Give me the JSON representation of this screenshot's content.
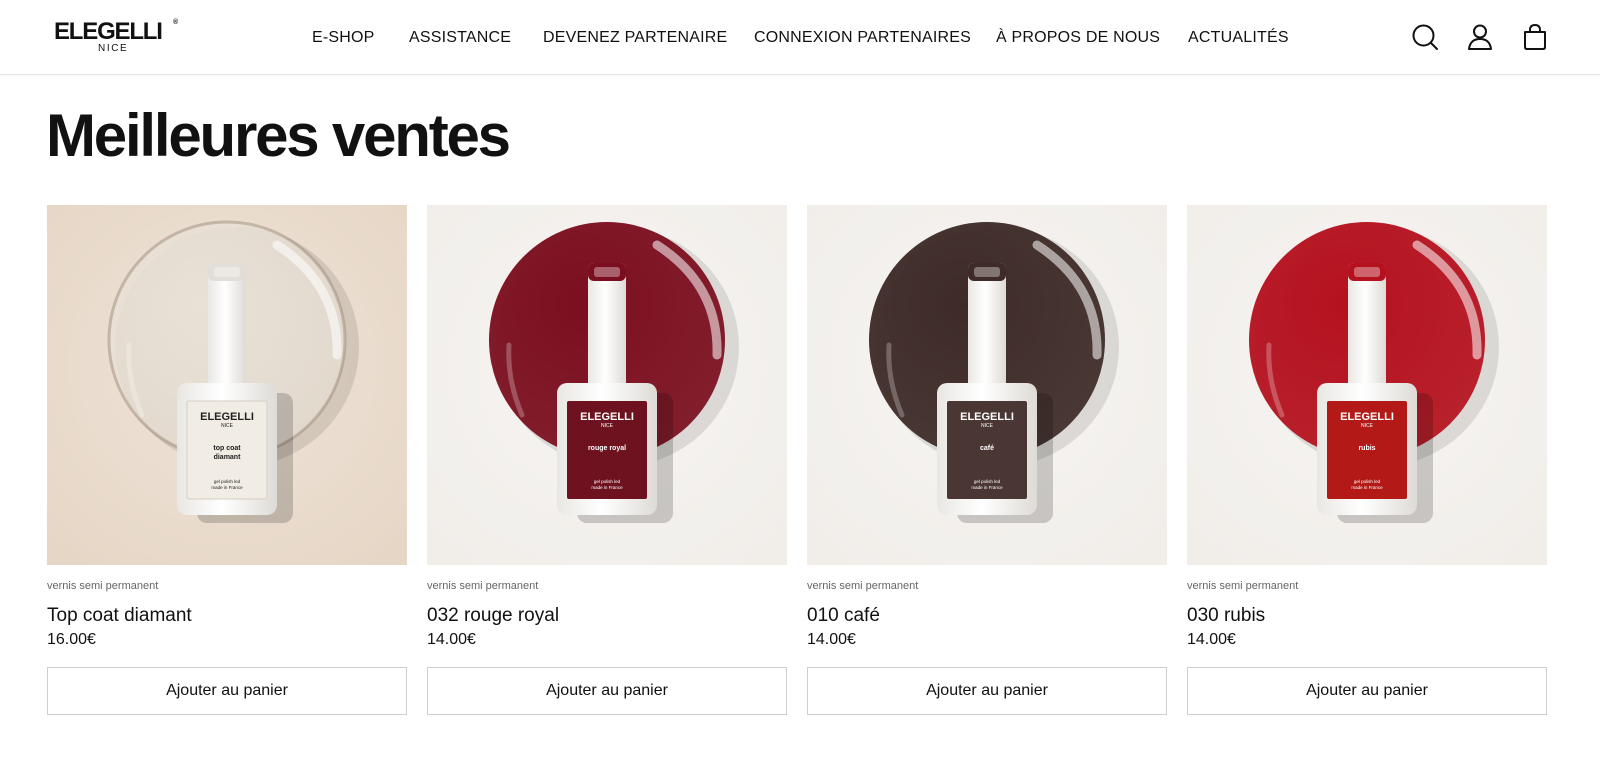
{
  "brand": {
    "logo_main": "ELEGELLI",
    "logo_registered": "®",
    "logo_sub": "NICE"
  },
  "nav": {
    "items": [
      {
        "label": "E-SHOP"
      },
      {
        "label": "ASSISTANCE"
      },
      {
        "label": "DEVENEZ PARTENAIRE"
      },
      {
        "label": "CONNEXION PARTENAIRES"
      },
      {
        "label": "À PROPOS DE NOUS"
      },
      {
        "label": "ACTUALITÉS"
      }
    ]
  },
  "header_icons": [
    "search-icon",
    "account-icon",
    "cart-icon"
  ],
  "section": {
    "title": "Meilleures ventes"
  },
  "products": [
    {
      "category": "vernis semi permanent",
      "name": "Top coat diamant",
      "price": "16.00€",
      "button": "Ajouter au panier",
      "bottle_brand": "ELEGELLI",
      "bottle_city": "NICE",
      "bottle_shade_line1": "top coat",
      "bottle_shade_line2": "diamant",
      "bottle_note_line1": "gel polish led",
      "bottle_note_line2": "made in France",
      "background_color": "#e6d6c6",
      "swatch_color": "#e9e1d6",
      "label_color": "#f1ece4"
    },
    {
      "category": "vernis semi permanent",
      "name": "032 rouge royal",
      "price": "14.00€",
      "button": "Ajouter au panier",
      "bottle_brand": "ELEGELLI",
      "bottle_city": "NICE",
      "bottle_shade_line1": "rouge royal",
      "bottle_shade_line2": "",
      "bottle_note_line1": "gel polish led",
      "bottle_note_line2": "made in France",
      "background_color": "#f1eeea",
      "swatch_color": "#7b0f1f",
      "label_color": "#6e1220"
    },
    {
      "category": "vernis semi permanent",
      "name": "010 café",
      "price": "14.00€",
      "button": "Ajouter au panier",
      "bottle_brand": "ELEGELLI",
      "bottle_city": "NICE",
      "bottle_shade_line1": "café",
      "bottle_shade_line2": "",
      "bottle_note_line1": "gel polish led",
      "bottle_note_line2": "made in France",
      "background_color": "#f1eeea",
      "swatch_color": "#3e2b27",
      "label_color": "#4a3632"
    },
    {
      "category": "vernis semi permanent",
      "name": "030 rubis",
      "price": "14.00€",
      "button": "Ajouter au panier",
      "bottle_brand": "ELEGELLI",
      "bottle_city": "NICE",
      "bottle_shade_line1": "rubis",
      "bottle_shade_line2": "",
      "bottle_note_line1": "gel polish led",
      "bottle_note_line2": "made in France",
      "background_color": "#f1eeea",
      "swatch_color": "#b5121f",
      "label_color": "#b31a17"
    }
  ]
}
